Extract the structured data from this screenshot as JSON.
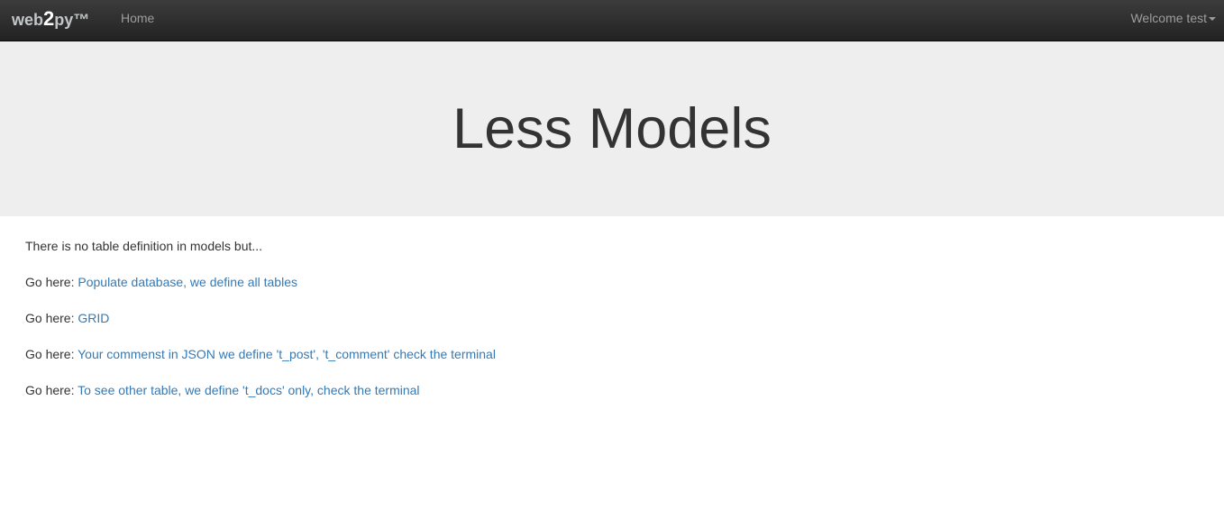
{
  "nav": {
    "brand_a": "web",
    "brand_b": "2",
    "brand_c": "py™",
    "home": "Home",
    "welcome": "Welcome test"
  },
  "hero": {
    "title": "Less Models"
  },
  "content": {
    "intro": "There is no table definition in models but...",
    "prefix": "Go here:",
    "links": [
      "Populate database, we define all tables",
      "GRID",
      "Your commenst in JSON we define 't_post', 't_comment' check the terminal",
      "To see other table, we define 't_docs' only, check the terminal"
    ]
  }
}
